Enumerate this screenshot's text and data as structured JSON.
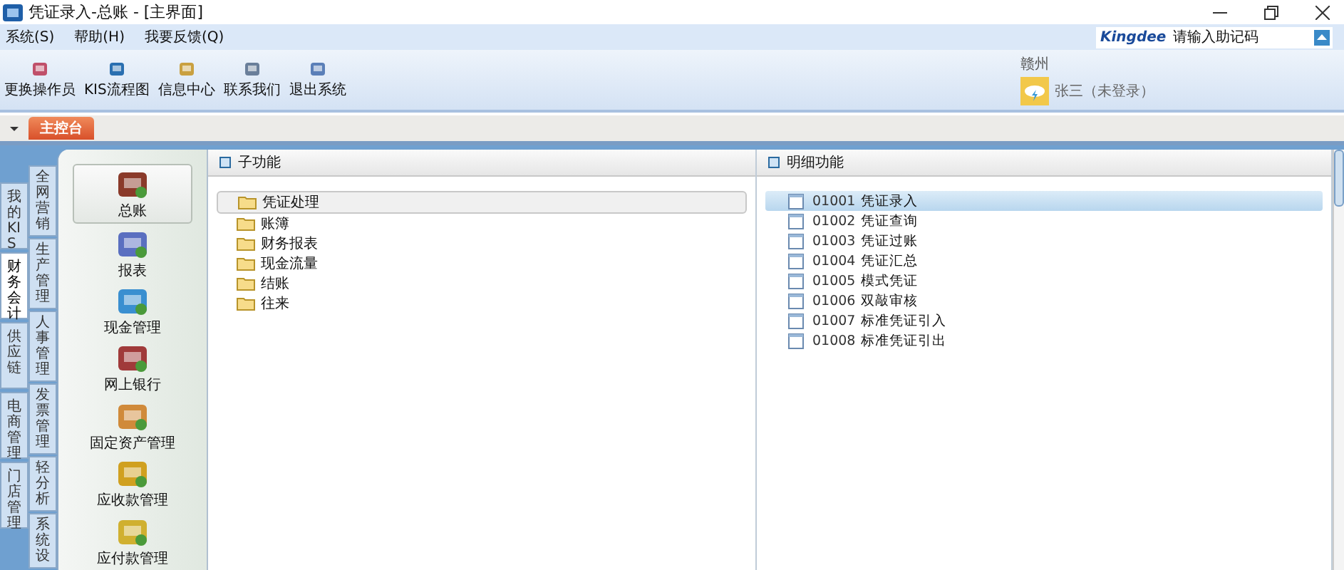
{
  "window": {
    "title": "凭证录入-总账 - [主界面]"
  },
  "menu": [
    "系统(S)",
    "帮助(H)",
    "我要反馈(Q)"
  ],
  "search": {
    "brand": "Kingdee",
    "placeholder": "请输入助记码"
  },
  "toolbar": [
    "更换操作员",
    "KIS流程图",
    "信息中心",
    "联系我们",
    "退出系统"
  ],
  "user": {
    "location": "赣州",
    "name": "张三（未登录）"
  },
  "console_tab": {
    "label": "主控台"
  },
  "category_tabs": [
    {
      "label": "我的KIS",
      "selected": false
    },
    {
      "label": "财务会计",
      "selected": true
    },
    {
      "label": "供应链",
      "selected": false
    },
    {
      "label": "电商管理",
      "selected": false
    },
    {
      "label": "门店管理",
      "selected": false
    }
  ],
  "category_tabs_2": [
    {
      "label": "全网营销",
      "selected": false
    },
    {
      "label": "生产管理",
      "selected": false
    },
    {
      "label": "人事管理",
      "selected": false
    },
    {
      "label": "发票管理",
      "selected": false
    },
    {
      "label": "轻分析",
      "selected": false
    },
    {
      "label": "系统设",
      "selected": false
    }
  ],
  "modules": [
    {
      "label": "总账",
      "selected": true
    },
    {
      "label": "报表",
      "selected": false
    },
    {
      "label": "现金管理",
      "selected": false
    },
    {
      "label": "网上银行",
      "selected": false
    },
    {
      "label": "固定资产管理",
      "selected": false
    },
    {
      "label": "应收款管理",
      "selected": false
    },
    {
      "label": "应付款管理",
      "selected": false
    }
  ],
  "subfunctions": {
    "title": "子功能",
    "items": [
      {
        "label": "凭证处理",
        "selected": true
      },
      {
        "label": "账簿",
        "selected": false
      },
      {
        "label": "财务报表",
        "selected": false
      },
      {
        "label": "现金流量",
        "selected": false
      },
      {
        "label": "结账",
        "selected": false
      },
      {
        "label": "往来",
        "selected": false
      }
    ]
  },
  "details": {
    "title": "明细功能",
    "items": [
      {
        "code": "01001",
        "label": "凭证录入",
        "selected": true
      },
      {
        "code": "01002",
        "label": "凭证查询",
        "selected": false
      },
      {
        "code": "01003",
        "label": "凭证过账",
        "selected": false
      },
      {
        "code": "01004",
        "label": "凭证汇总",
        "selected": false
      },
      {
        "code": "01005",
        "label": "模式凭证",
        "selected": false
      },
      {
        "code": "01006",
        "label": "双敲审核",
        "selected": false
      },
      {
        "code": "01007",
        "label": "标准凭证引入",
        "selected": false
      },
      {
        "code": "01008",
        "label": "标准凭证引出",
        "selected": false
      }
    ]
  }
}
